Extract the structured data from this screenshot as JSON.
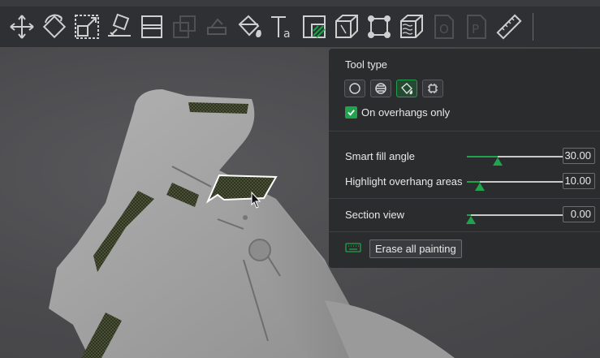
{
  "toolbar": {
    "icons": [
      "move-icon",
      "rotate-icon",
      "scale-icon",
      "place-on-face-icon",
      "cut-icon",
      "arrange-icon",
      "support-paint-disabled-icon",
      "paint-bucket-icon",
      "text-icon",
      "seam-paint-icon",
      "measure-box-icon",
      "fit-bounds-icon",
      "fuzzy-skin-icon",
      "page-o-icon",
      "page-p-icon",
      "ruler-icon"
    ]
  },
  "panel": {
    "tool_type_label": "Tool type",
    "tools": [
      "circle-tool-icon",
      "sphere-tool-icon",
      "fill-tool-icon",
      "gap-fill-tool-icon"
    ],
    "active_tool": 2,
    "on_overhangs_only": {
      "label": "On overhangs only",
      "checked": true
    },
    "sliders": [
      {
        "label": "Smart fill angle",
        "value": "30.00",
        "fraction": 0.3
      },
      {
        "label": "Highlight overhang areas",
        "value": "10.00",
        "fraction": 0.13
      },
      {
        "label": "Section view",
        "value": "0.00",
        "fraction": 0.04
      }
    ],
    "erase_label": "Erase all painting"
  },
  "colors": {
    "accent": "#1fa34c",
    "panel_bg": "#2b2c2e",
    "toolbar_bg": "#2f3033"
  }
}
